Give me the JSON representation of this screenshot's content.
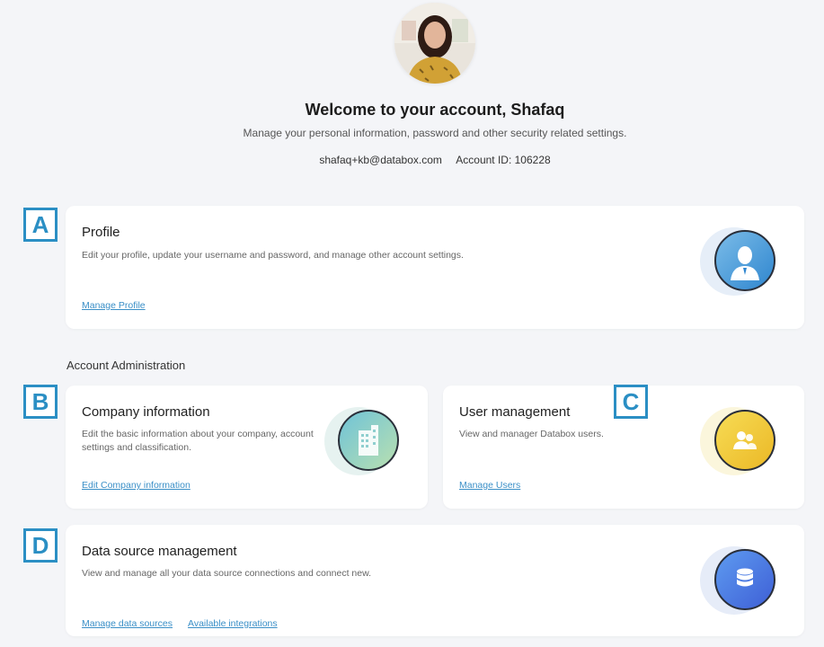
{
  "header": {
    "title": "Welcome to your account, Shafaq",
    "subtitle": "Manage your personal information, password and other security related settings.",
    "email": "shafaq+kb@databox.com",
    "account_id": "Account ID: 106228"
  },
  "profile": {
    "title": "Profile",
    "description": "Edit your profile, update your username and password, and manage other account settings.",
    "link": "Manage Profile",
    "icon": "user-silhouette-icon",
    "color": "#3d8fd0"
  },
  "section_label": "Account Administration",
  "company": {
    "title": "Company information",
    "description": "Edit the basic information about your company, account settings and classification.",
    "link": "Edit Company information",
    "icon": "building-icon",
    "color": "#8fd3c4"
  },
  "users": {
    "title": "User management",
    "description": "View and manager Databox users.",
    "link": "Manage Users",
    "icon": "users-icon",
    "color": "#f2c830"
  },
  "datasource": {
    "title": "Data source management",
    "description": "View and manage all your data source connections and connect new.",
    "link_1": "Manage data sources",
    "link_2": "Available integrations",
    "icon": "database-icon",
    "color": "#4a7ee0"
  },
  "markers": {
    "a": "A",
    "b": "B",
    "c": "C",
    "d": "D"
  }
}
